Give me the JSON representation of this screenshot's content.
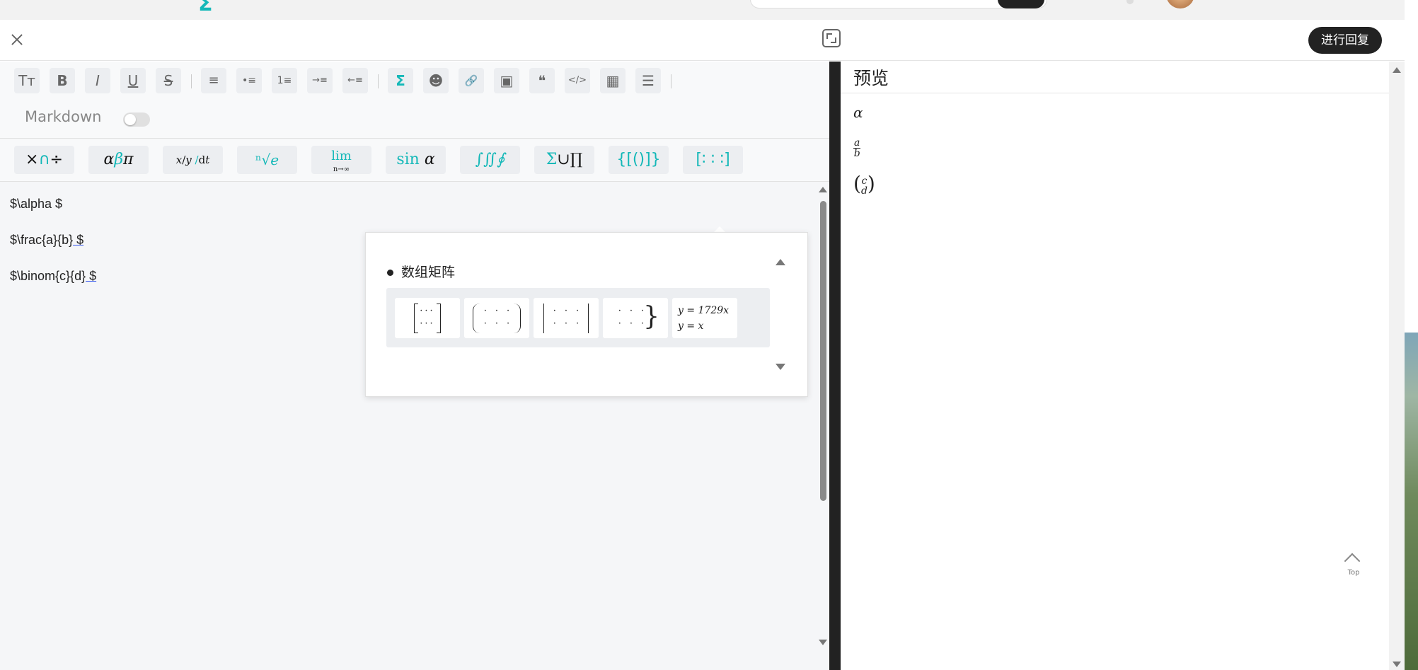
{
  "header": {
    "reply_label": "进行回复"
  },
  "toolbar": {
    "buttons": [
      {
        "name": "text-size",
        "glyph": "Tт"
      },
      {
        "name": "bold",
        "glyph": "B"
      },
      {
        "name": "italic",
        "glyph": "I"
      },
      {
        "name": "underline",
        "glyph": "U"
      },
      {
        "name": "strikethrough",
        "glyph": "S"
      },
      {
        "name": "align-left",
        "glyph": "≡"
      },
      {
        "name": "bullet-list",
        "glyph": "•≡"
      },
      {
        "name": "ordered-list",
        "glyph": "1≡"
      },
      {
        "name": "indent",
        "glyph": "→≡"
      },
      {
        "name": "outdent",
        "glyph": "←≡"
      },
      {
        "name": "formula",
        "glyph": "Σ"
      },
      {
        "name": "emoji",
        "glyph": "☻"
      },
      {
        "name": "link",
        "glyph": "🔗"
      },
      {
        "name": "image",
        "glyph": "▣"
      },
      {
        "name": "quote",
        "glyph": "❝"
      },
      {
        "name": "code",
        "glyph": "</>"
      },
      {
        "name": "table",
        "glyph": "▦"
      },
      {
        "name": "horizontal-rule",
        "glyph": "☰"
      }
    ],
    "markdown_label": "Markdown"
  },
  "formula_toolbar": {
    "buttons": [
      {
        "name": "operators",
        "label": "×∩÷"
      },
      {
        "name": "greek",
        "label": "αβπ"
      },
      {
        "name": "fractions",
        "label": "x/y ⁄ dt"
      },
      {
        "name": "roots",
        "label": "ⁿ√e"
      },
      {
        "name": "limits",
        "label": "lim"
      },
      {
        "name": "functions",
        "label": "sin α"
      },
      {
        "name": "integrals",
        "label": "∫∬∮"
      },
      {
        "name": "big-operators",
        "label": "Σ∪∏"
      },
      {
        "name": "brackets",
        "label": "{[()]}"
      },
      {
        "name": "matrices",
        "label": "[∶ ∶ ∶]"
      }
    ]
  },
  "editor": {
    "lines": [
      {
        "pre": "$\\alpha $",
        "ul": ""
      },
      {
        "pre": "$\\frac{a}{b}",
        "ul": " $"
      },
      {
        "pre": "$\\binom{c}{d}",
        "ul": " $"
      }
    ]
  },
  "popup": {
    "title": "数组矩阵",
    "items": [
      {
        "name": "bracket-matrix",
        "type": "brackets"
      },
      {
        "name": "paren-matrix",
        "type": "parens"
      },
      {
        "name": "vbar-matrix",
        "type": "vbars"
      },
      {
        "name": "brace-matrix",
        "type": "brace"
      },
      {
        "name": "equation-system",
        "type": "equations",
        "line1": "y = 1729x",
        "line2": "y = x"
      }
    ]
  },
  "preview": {
    "title": "预览",
    "alpha": "α",
    "frac_num": "a",
    "frac_den": "b",
    "binom_top": "c",
    "binom_bottom": "d"
  },
  "top_button": {
    "label": "Top"
  },
  "colors": {
    "accent": "#14b8b8",
    "dark": "#222222"
  }
}
